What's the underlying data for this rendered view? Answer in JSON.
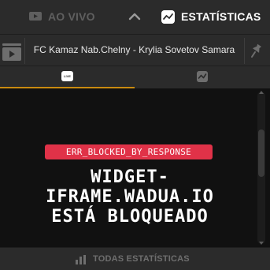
{
  "header": {
    "live_tab_label": "AO VIVO",
    "live_icon": "tv-icon",
    "collapse_icon": "chevron-up-icon",
    "stats_tab_label": "ESTATÍSTICAS",
    "stats_icon": "stats-icon"
  },
  "match": {
    "video_icon": "video-icon",
    "title": "FC Kamaz Nab.Chelny - Krylia Sovetov Samara",
    "pin_icon": "pin-icon"
  },
  "subtabs": [
    {
      "name": "live",
      "icon": "live-icon",
      "icon_text": "LIVE",
      "active": true
    },
    {
      "name": "stats",
      "icon": "stats-icon",
      "active": false
    }
  ],
  "widget": {
    "error_code": "ERR_BLOCKED_BY_RESPONSE",
    "message_line1": "widget-",
    "message_line2": "iframe.wadua.io",
    "message_line3": "está bloqueado"
  },
  "footer": {
    "all_stats_label": "TODAS ESTATÍSTICAS",
    "icon": "bar-chart-icon"
  },
  "colors": {
    "accent": "#c98a10",
    "error_badge": "#e03248",
    "background": "#2b2b2b",
    "content_bg": "#111111"
  }
}
